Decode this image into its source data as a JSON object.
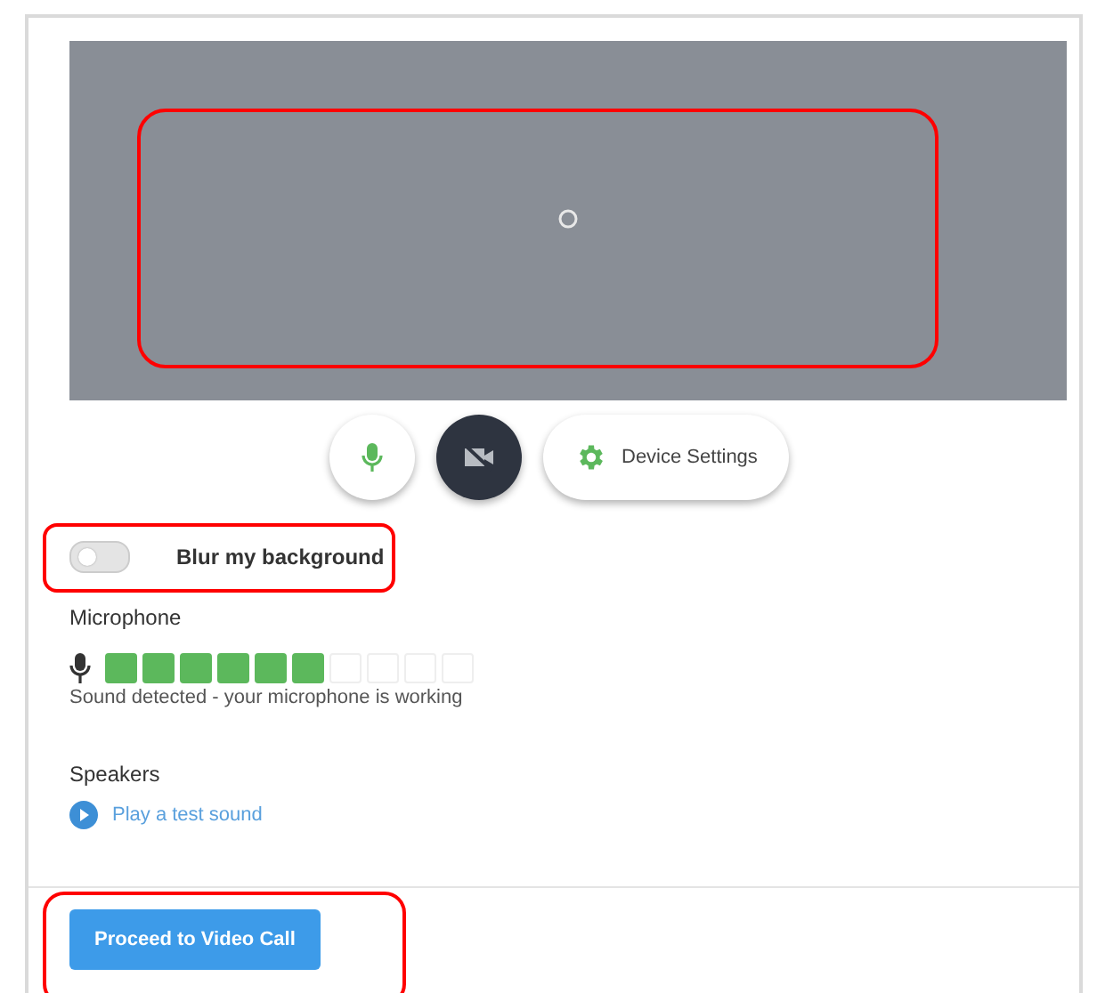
{
  "video": {
    "loading": true,
    "highlighted": true
  },
  "controls": {
    "mic_on": true,
    "camera_on": false,
    "device_settings": "Device Settings"
  },
  "blur": {
    "label": "Blur my background",
    "on": false,
    "highlighted": true
  },
  "microphone": {
    "title": "Microphone",
    "level": 0.6,
    "status": "Sound detected - your microphone is working"
  },
  "speakers": {
    "title": "Speakers",
    "test_link": "Play a test sound"
  },
  "proceed": {
    "label": "Proceed to Video Call",
    "highlighted": true
  }
}
